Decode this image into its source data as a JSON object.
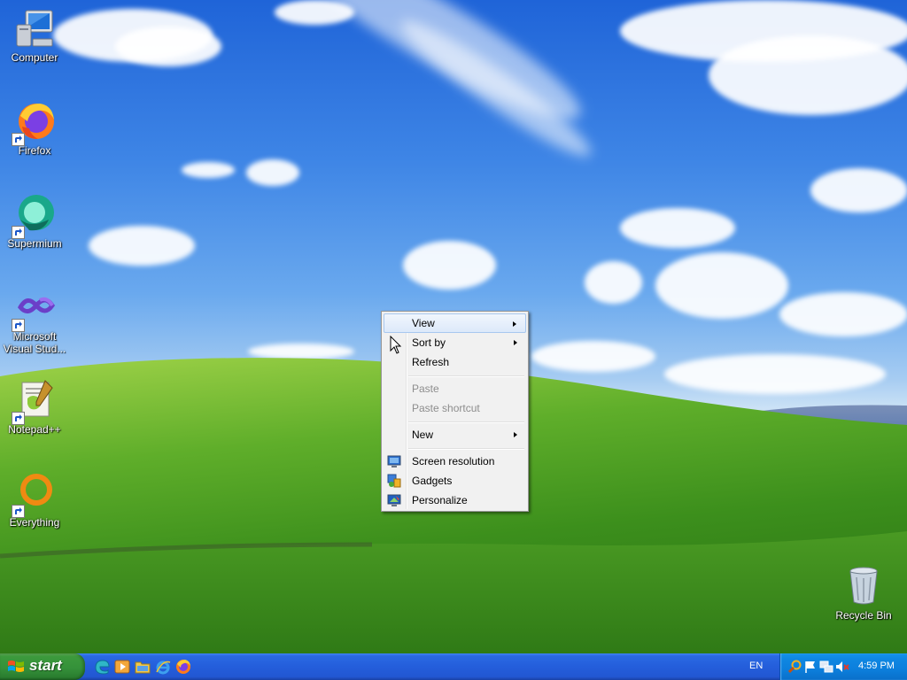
{
  "desktop": {
    "icons": [
      {
        "label": "Computer",
        "icon": "computer-icon"
      },
      {
        "label": "Firefox",
        "icon": "firefox-icon"
      },
      {
        "label": "Supermium",
        "icon": "supermium-icon"
      },
      {
        "label": "Microsoft Visual Stud...",
        "icon": "visual-studio-icon"
      },
      {
        "label": "Notepad++",
        "icon": "notepadpp-icon"
      },
      {
        "label": "Everything",
        "icon": "everything-icon"
      },
      {
        "label": "Recycle Bin",
        "icon": "recycle-bin-icon"
      }
    ]
  },
  "context_menu": {
    "items": [
      {
        "label": "View",
        "submenu": true,
        "highlighted": true
      },
      {
        "label": "Sort by",
        "submenu": true
      },
      {
        "label": "Refresh"
      },
      {
        "label": "Paste",
        "disabled": true
      },
      {
        "label": "Paste shortcut",
        "disabled": true
      },
      {
        "label": "New",
        "submenu": true
      },
      {
        "label": "Screen resolution",
        "icon": "monitor-icon"
      },
      {
        "label": "Gadgets",
        "icon": "gadgets-icon"
      },
      {
        "label": "Personalize",
        "icon": "personalize-icon"
      }
    ]
  },
  "taskbar": {
    "start_label": "start",
    "quick_launch": [
      "edge-icon",
      "media-player-icon",
      "file-explorer-icon",
      "internet-explorer-icon",
      "firefox-icon"
    ],
    "language": "EN",
    "tray_icons": [
      "search-icon",
      "action-center-flag-icon",
      "network-icon",
      "volume-muted-icon"
    ],
    "clock": "4:59 PM"
  },
  "colors": {
    "taskbar_blue": "#245edb",
    "start_green": "#35913a",
    "tray_blue": "#0c7fdc",
    "menu_highlight": "#dde9fa"
  }
}
